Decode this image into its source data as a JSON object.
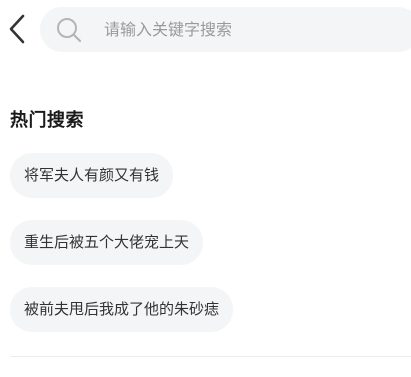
{
  "nav": {
    "back_icon": "chevron-left-icon"
  },
  "search": {
    "icon": "search-icon",
    "placeholder": "请输入关键字搜索",
    "value": ""
  },
  "hot_search": {
    "title": "热门搜索",
    "items": [
      {
        "label": "将军夫人有颜又有钱"
      },
      {
        "label": "重生后被五个大佬宠上天"
      },
      {
        "label": "被前夫甩后我成了他的朱砂痣"
      }
    ]
  },
  "colors": {
    "background": "#ffffff",
    "chip_background": "#f4f5f7",
    "placeholder": "#9a9a9a",
    "text": "#333333"
  }
}
